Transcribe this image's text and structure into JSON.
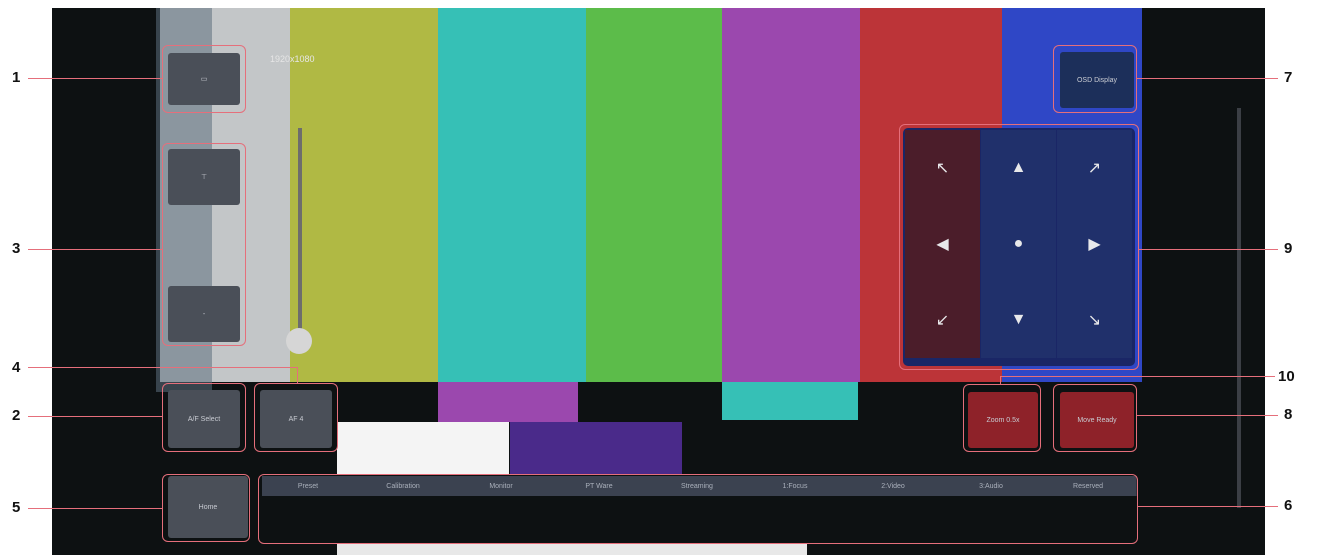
{
  "colors": {
    "frame": "#e56f7b",
    "bg": "#0d1112"
  },
  "callouts": [
    "1",
    "2",
    "3",
    "4",
    "5",
    "6",
    "7",
    "8",
    "9",
    "10"
  ],
  "overlay_text": {
    "top": "1920x1080",
    "preset_icon": "▭"
  },
  "buttons": {
    "b1": "▭",
    "b2": "A/F Select",
    "b3_top": "⊤",
    "b3_bottom": "-",
    "b4": "AF 4",
    "b5": "Home",
    "b7": "OSD Display",
    "b8": "Move Ready",
    "b10": "Zoom 0.5x"
  },
  "tabs": [
    "Preset",
    "Calibration",
    "Monitor",
    "PT Ware",
    "Streaming",
    "1:Focus",
    "2:Video",
    "3:Audio",
    "Reserved"
  ],
  "pad": {
    "icons": [
      "↖",
      "▲",
      "↗",
      "◀",
      "●",
      "▶",
      "↙",
      "▼",
      "↘"
    ]
  }
}
